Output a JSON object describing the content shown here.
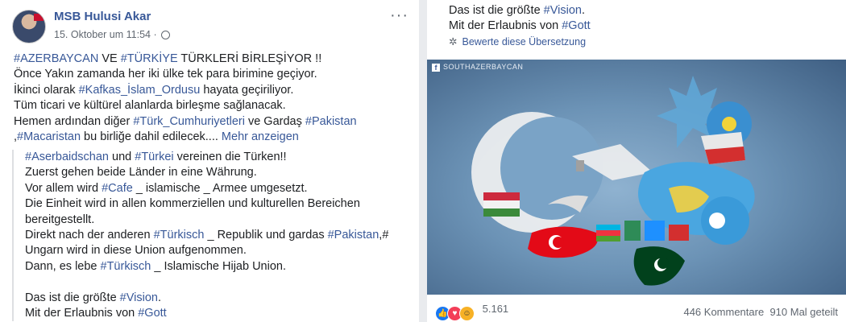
{
  "post": {
    "author": "MSB Hulusi Akar",
    "date": "15. Oktober um 11:54 ·",
    "more_icon": "···",
    "lines": [
      [
        {
          "t": "#AZERBAYCAN",
          "tag": true
        },
        {
          "t": " VE "
        },
        {
          "t": "#TÜRKİYE",
          "tag": true
        },
        {
          "t": " TÜRKLERİ BİRLEŞİYOR !!"
        }
      ],
      [
        {
          "t": "Önce Yakın zamanda her iki ülke tek para birimine geçiyor."
        }
      ],
      [
        {
          "t": "İkinci olarak "
        },
        {
          "t": "#Kafkas_İslam_Ordusu",
          "tag": true
        },
        {
          "t": " hayata geçiriliyor."
        }
      ],
      [
        {
          "t": "Tüm ticari ve kültürel alanlarda birleşme sağlanacak."
        }
      ],
      [
        {
          "t": "Hemen ardından diğer "
        },
        {
          "t": "#Türk_Cumhuriyetleri",
          "tag": true
        },
        {
          "t": " ve Gardaş "
        },
        {
          "t": "#Pakistan",
          "tag": true
        }
      ],
      [
        {
          "t": ","
        },
        {
          "t": "#Macaristan",
          "tag": true
        },
        {
          "t": " bu birliğe dahil edilecek.... "
        },
        {
          "t": "Mehr anzeigen",
          "more": true
        }
      ]
    ],
    "translation_lines": [
      [
        {
          "t": "#Aserbaidschan",
          "tag": true
        },
        {
          "t": " und "
        },
        {
          "t": "#Türkei",
          "tag": true
        },
        {
          "t": " vereinen die Türken!!"
        }
      ],
      [
        {
          "t": "Zuerst gehen beide Länder in eine Währung."
        }
      ],
      [
        {
          "t": "Vor allem wird "
        },
        {
          "t": "#Cafe",
          "tag": true
        },
        {
          "t": " _ islamische _ Armee umgesetzt."
        }
      ],
      [
        {
          "t": "Die Einheit wird in allen kommerziellen und kulturellen Bereichen"
        }
      ],
      [
        {
          "t": "bereitgestellt."
        }
      ],
      [
        {
          "t": "Direkt nach der anderen "
        },
        {
          "t": "#Türkisch",
          "tag": true
        },
        {
          "t": " _ Republik und gardas "
        },
        {
          "t": "#Pakistan",
          "tag": true
        },
        {
          "t": ",#"
        }
      ],
      [
        {
          "t": "Ungarn wird in diese Union aufgenommen."
        }
      ],
      [
        {
          "t": "Dann, es lebe "
        },
        {
          "t": "#Türkisch",
          "tag": true
        },
        {
          "t": " _ Islamische Hijab Union."
        }
      ],
      [],
      [
        {
          "t": "Das ist die größte "
        },
        {
          "t": "#Vision",
          "tag": true
        },
        {
          "t": "."
        }
      ],
      [
        {
          "t": "Mit der Erlaubnis von "
        },
        {
          "t": "#Gott",
          "tag": true
        }
      ]
    ]
  },
  "right": {
    "lines": [
      [
        {
          "t": "Das ist die größte "
        },
        {
          "t": "#Vision",
          "tag": true
        },
        {
          "t": "."
        }
      ],
      [
        {
          "t": "Mit der Erlaubnis von "
        },
        {
          "t": "#Gott",
          "tag": true
        }
      ]
    ],
    "rate_label": "Bewerte diese Übersetzung",
    "image_source": "SOUTHAZERBAYCAN",
    "reaction_count": "5.161",
    "comments": "446 Kommentare",
    "shares": "910 Mal geteilt"
  }
}
